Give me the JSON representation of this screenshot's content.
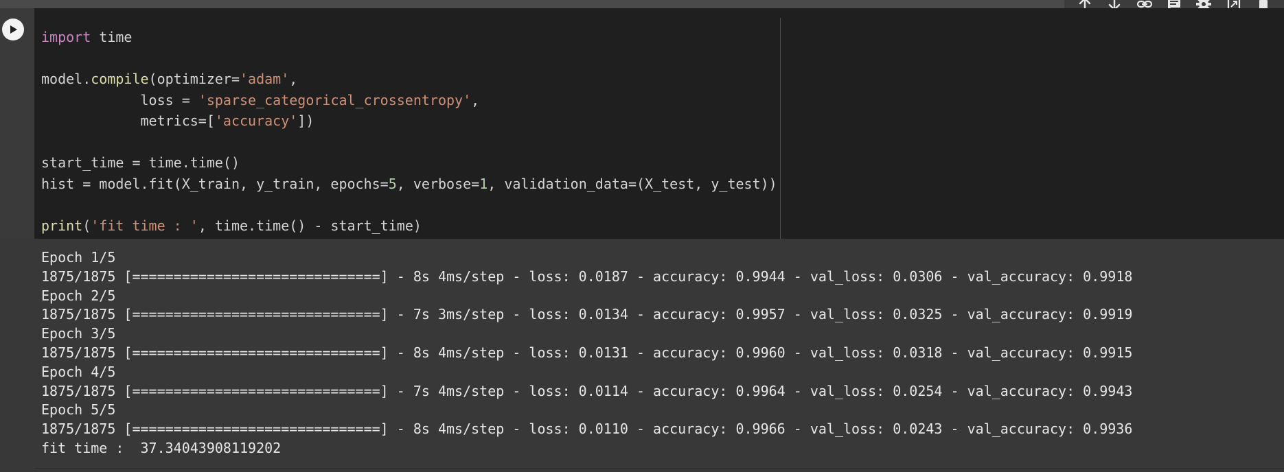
{
  "cell": {
    "code_lines": [
      [
        {
          "t": "import",
          "c": "kw"
        },
        {
          "t": " time"
        }
      ],
      [],
      [
        {
          "t": "model."
        },
        {
          "t": "compile",
          "c": "fn"
        },
        {
          "t": "(optimizer="
        },
        {
          "t": "'adam'",
          "c": "str"
        },
        {
          "t": ","
        }
      ],
      [
        {
          "t": "            loss = "
        },
        {
          "t": "'sparse_categorical_crossentropy'",
          "c": "str"
        },
        {
          "t": ","
        }
      ],
      [
        {
          "t": "            metrics=["
        },
        {
          "t": "'accuracy'",
          "c": "str"
        },
        {
          "t": "])"
        }
      ],
      [],
      [
        {
          "t": "start_time = time.time()"
        }
      ],
      [
        {
          "t": "hist = model.fit(X_train, y_train, epochs="
        },
        {
          "t": "5",
          "c": "num"
        },
        {
          "t": ", verbose="
        },
        {
          "t": "1",
          "c": "num"
        },
        {
          "t": ", validation_data=(X_test, y_test))"
        }
      ],
      [],
      [
        {
          "t": "print",
          "c": "fn"
        },
        {
          "t": "("
        },
        {
          "t": "'fit time : '",
          "c": "str"
        },
        {
          "t": ", time.time() - start_time)"
        }
      ]
    ]
  },
  "output": {
    "lines": [
      "Epoch 1/5",
      "1875/1875 [==============================] - 8s 4ms/step - loss: 0.0187 - accuracy: 0.9944 - val_loss: 0.0306 - val_accuracy: 0.9918",
      "Epoch 2/5",
      "1875/1875 [==============================] - 7s 3ms/step - loss: 0.0134 - accuracy: 0.9957 - val_loss: 0.0325 - val_accuracy: 0.9919",
      "Epoch 3/5",
      "1875/1875 [==============================] - 8s 4ms/step - loss: 0.0131 - accuracy: 0.9960 - val_loss: 0.0318 - val_accuracy: 0.9915",
      "Epoch 4/5",
      "1875/1875 [==============================] - 7s 4ms/step - loss: 0.0114 - accuracy: 0.9964 - val_loss: 0.0254 - val_accuracy: 0.9943",
      "Epoch 5/5",
      "1875/1875 [==============================] - 8s 4ms/step - loss: 0.0110 - accuracy: 0.9966 - val_loss: 0.0243 - val_accuracy: 0.9936",
      "fit time :  37.34043908119202"
    ]
  },
  "toolbar": {
    "icons": [
      "arrow-up-icon",
      "arrow-down-icon",
      "link-icon",
      "comment-icon",
      "gear-icon",
      "mirror-cell-icon",
      "trash-icon"
    ]
  },
  "colors": {
    "keyword": "#c586c0",
    "function": "#dcdcaa",
    "string": "#ce9178",
    "number": "#b5cea8",
    "editor_bg": "#1f1f1f",
    "output_bg": "#383838"
  }
}
